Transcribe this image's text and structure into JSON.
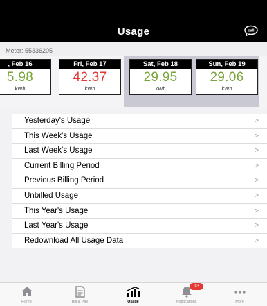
{
  "header": {
    "title": "Usage",
    "icon": "speech-bubble-icon",
    "icon_text": "call"
  },
  "meter": {
    "label": "Meter: 55336205"
  },
  "days": [
    {
      "date": ", Feb 16",
      "value": "5.98",
      "unit": "kWh",
      "color": "#7aa53a"
    },
    {
      "date": "Fri, Feb 17",
      "value": "42.37",
      "unit": "kWh",
      "color": "#e53935"
    },
    {
      "date": "Sat, Feb 18",
      "value": "29.95",
      "unit": "kWh",
      "color": "#7aa53a"
    },
    {
      "date": "Sun, Feb 19",
      "value": "29.06",
      "unit": "kWh",
      "color": "#7aa53a"
    }
  ],
  "menu": [
    {
      "label": "Yesterday's Usage",
      "chevron": ">"
    },
    {
      "label": "This Week's Usage",
      "chevron": ">"
    },
    {
      "label": "Last Week's Usage",
      "chevron": ">"
    },
    {
      "label": "Current Billing Period",
      "chevron": ">"
    },
    {
      "label": "Previous Billing Period",
      "chevron": ">"
    },
    {
      "label": "Unbilled Usage",
      "chevron": ">"
    },
    {
      "label": "This Year's Usage",
      "chevron": ">"
    },
    {
      "label": "Last Year's Usage",
      "chevron": ">"
    },
    {
      "label": "Redownload All Usage Data",
      "chevron": ">"
    }
  ],
  "tabs": [
    {
      "label": "Home",
      "icon": "home-icon"
    },
    {
      "label": "Bill & Pay",
      "icon": "bill-icon"
    },
    {
      "label": "Usage",
      "icon": "usage-chart-icon",
      "active": true
    },
    {
      "label": "Notifications",
      "icon": "bell-icon",
      "badge": "13"
    },
    {
      "label": "More",
      "icon": "more-dots-icon"
    }
  ],
  "colors": {
    "header_bg": "#000000",
    "accent_red": "#e53935",
    "accent_green": "#7aa53a"
  }
}
